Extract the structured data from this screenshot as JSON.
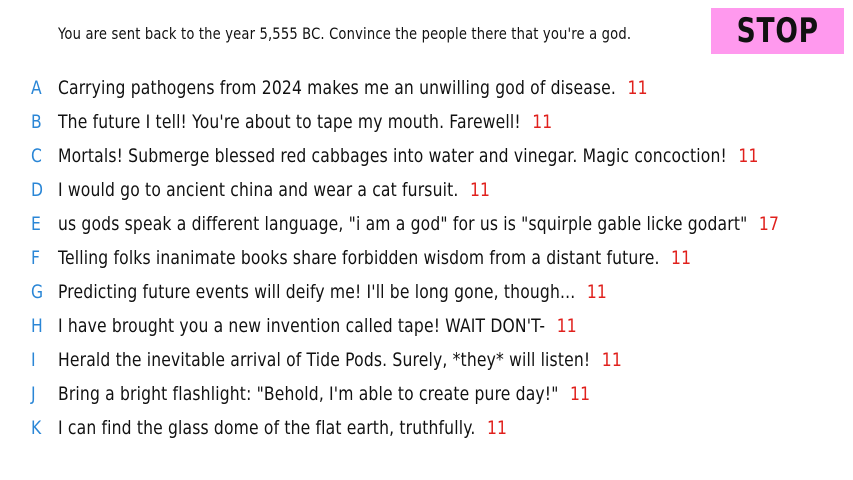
{
  "prompt": "You are sent back to the year 5,555 BC. Convince the people there that you're a god.",
  "stop_label": "STOP",
  "colors": {
    "letter": "#2a86d6",
    "score": "#e0201c",
    "stop_background": "#ff99ee"
  },
  "answers": [
    {
      "letter": "A",
      "text": "Carrying pathogens from 2024 makes me an unwilling god of disease.",
      "score": "11"
    },
    {
      "letter": "B",
      "text": "The future I tell! You're about to tape my mouth. Farewell!",
      "score": "11"
    },
    {
      "letter": "C",
      "text": "Mortals! Submerge blessed red cabbages into water and vinegar. Magic concoction!",
      "score": "11"
    },
    {
      "letter": "D",
      "text": "I would go to ancient china and wear a cat fursuit.",
      "score": "11"
    },
    {
      "letter": "E",
      "text": "us gods speak a different language, \"i am a god\" for us is \"squirple gable licke godart\"",
      "score": "17"
    },
    {
      "letter": "F",
      "text": "Telling folks inanimate books share forbidden wisdom from a distant future.",
      "score": "11"
    },
    {
      "letter": "G",
      "text": "Predicting future events will deify me! I'll be long gone, though...",
      "score": "11"
    },
    {
      "letter": "H",
      "text": "I have brought you a new invention called tape! WAIT DON'T-",
      "score": "11"
    },
    {
      "letter": "I",
      "text": "Herald the inevitable arrival of Tide Pods. Surely, *they* will listen!",
      "score": "11"
    },
    {
      "letter": "J",
      "text": "Bring a bright flashlight: \"Behold, I'm able to create pure day!\"",
      "score": "11"
    },
    {
      "letter": "K",
      "text": "I can find the glass dome of the flat earth, truthfully.",
      "score": "11"
    }
  ]
}
